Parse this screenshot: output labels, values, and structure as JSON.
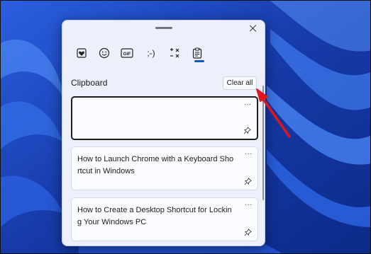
{
  "panel": {
    "tabs": [
      {
        "name": "kaomoji-favorites",
        "icon": "heart-icon"
      },
      {
        "name": "emoji",
        "icon": "smiley-icon"
      },
      {
        "name": "gif",
        "icon": "gif-icon",
        "label": "GIF"
      },
      {
        "name": "kaomoji",
        "icon": "kaomoji-icon",
        "label": ";-)"
      },
      {
        "name": "symbols",
        "icon": "symbols-icon"
      },
      {
        "name": "clipboard",
        "icon": "clipboard-icon"
      }
    ],
    "section_title": "Clipboard",
    "clear_all_label": "Clear all",
    "items": [
      {
        "text": "",
        "more": "···"
      },
      {
        "text": "How to Launch Chrome with a Keyboard Shortcut in Windows",
        "more": "···"
      },
      {
        "text": "How to Create a Desktop Shortcut for Locking Your Windows PC",
        "more": "···"
      }
    ]
  },
  "colors": {
    "accent": "#1558b8",
    "annotation_arrow": "#e0161d",
    "wallpaper": "#1a3fb8"
  }
}
